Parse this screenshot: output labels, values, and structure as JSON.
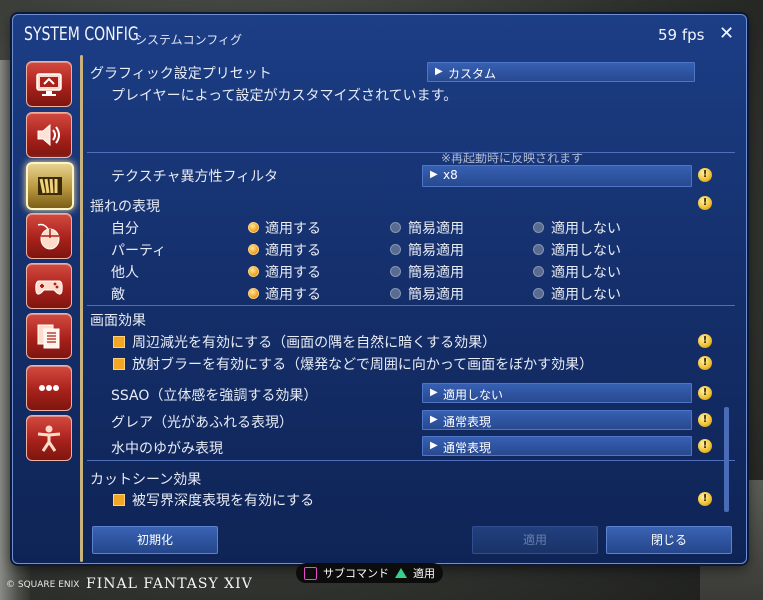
{
  "window": {
    "title_main": "SYSTEM CONFIG",
    "title_sub": "システムコンフィグ",
    "fps": "59 fps",
    "close_label": "✕"
  },
  "sidebar": {
    "items": [
      {
        "icon": "monitor-icon"
      },
      {
        "icon": "speaker-icon"
      },
      {
        "icon": "graphics-bars-icon",
        "active": true
      },
      {
        "icon": "mouse-icon"
      },
      {
        "icon": "gamepad-icon"
      },
      {
        "icon": "documents-icon"
      },
      {
        "icon": "more-icon"
      },
      {
        "icon": "character-icon"
      }
    ]
  },
  "preset": {
    "label": "グラフィック設定プリセット",
    "value": "カスタム",
    "description": "プレイヤーによって設定がカスタマイズされています。",
    "restart_note": "※再起動時に反映されます"
  },
  "texture_filter": {
    "label": "テクスチャ異方性フィルタ",
    "value": "x8"
  },
  "sway": {
    "header": "揺れの表現",
    "options": [
      "適用する",
      "簡易適用",
      "適用しない"
    ],
    "rows": [
      {
        "label": "自分",
        "selected": 0
      },
      {
        "label": "パーティ",
        "selected": 0
      },
      {
        "label": "他人",
        "selected": 0
      },
      {
        "label": "敵",
        "selected": 0
      }
    ]
  },
  "screen_effects": {
    "header": "画面効果",
    "checks": [
      {
        "label": "周辺減光を有効にする（画面の隅を自然に暗くする効果）",
        "checked": true
      },
      {
        "label": "放射ブラーを有効にする（爆発などで周囲に向かって画面をぼかす効果）",
        "checked": true
      }
    ],
    "dropdowns": [
      {
        "label": "SSAO（立体感を強調する効果）",
        "value": "適用しない"
      },
      {
        "label": "グレア（光があふれる表現）",
        "value": "通常表現"
      },
      {
        "label": "水中のゆがみ表現",
        "value": "通常表現"
      }
    ]
  },
  "cutscene": {
    "header": "カットシーン効果",
    "check": {
      "label": "被写界深度表現を有効にする",
      "checked": true
    }
  },
  "buttons": {
    "reset": "初期化",
    "apply": "適用",
    "close": "閉じる"
  },
  "footer": {
    "subcommand": "サブコマンド",
    "apply": "適用"
  },
  "branding": {
    "square_enix": "© SQUARE ENIX",
    "final_fantasy": "FINAL FANTASY XIV"
  },
  "colors": {
    "accent": "#f2a624",
    "window_bg": "#15306d",
    "close_button": "#a9211b"
  }
}
